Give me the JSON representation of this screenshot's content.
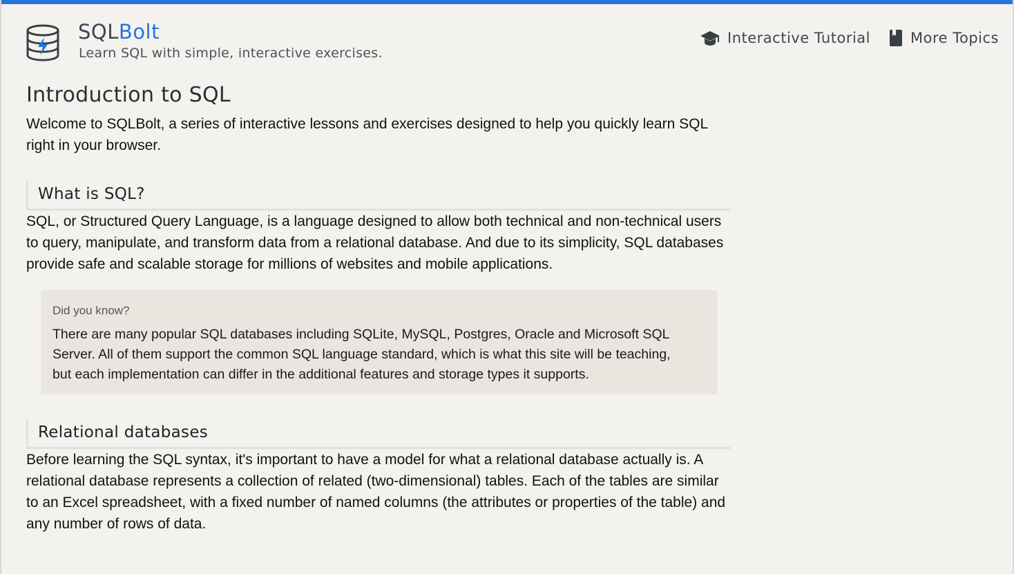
{
  "header": {
    "brand_part1": "SQL",
    "brand_part2": "Bolt",
    "tagline": "Learn SQL with simple, interactive exercises.",
    "accent_color": "#2874d8",
    "logo_icon": "database-bolt-icon"
  },
  "nav": {
    "items": [
      {
        "label": "Interactive Tutorial",
        "icon": "graduation-cap-icon"
      },
      {
        "label": "More Topics",
        "icon": "book-icon"
      }
    ]
  },
  "main": {
    "title": "Introduction to SQL",
    "intro": "Welcome to SQLBolt, a series of interactive lessons and exercises designed to help you quickly learn SQL right in your browser.",
    "sections": [
      {
        "heading": "What is SQL?",
        "paragraph": "SQL, or Structured Query Language, is a language designed to allow both technical and non-technical users to query, manipulate, and transform data from a relational database. And due to its simplicity, SQL databases provide safe and scalable storage for millions of websites and mobile applications."
      },
      {
        "heading": "Relational databases",
        "paragraph": "Before learning the SQL syntax, it's important to have a model for what a relational database actually is. A relational database represents a collection of related (two-dimensional) tables. Each of the tables are similar to an Excel spreadsheet, with a fixed number of named columns (the attributes or properties of the table) and any number of rows of data."
      }
    ],
    "callout": {
      "title": "Did you know?",
      "text": "There are many popular SQL databases including SQLite, MySQL, Postgres, Oracle and Microsoft SQL Server. All of them support the common SQL language standard, which is what this site will be teaching, but each implementation can differ in the additional features and storage types it supports."
    }
  }
}
